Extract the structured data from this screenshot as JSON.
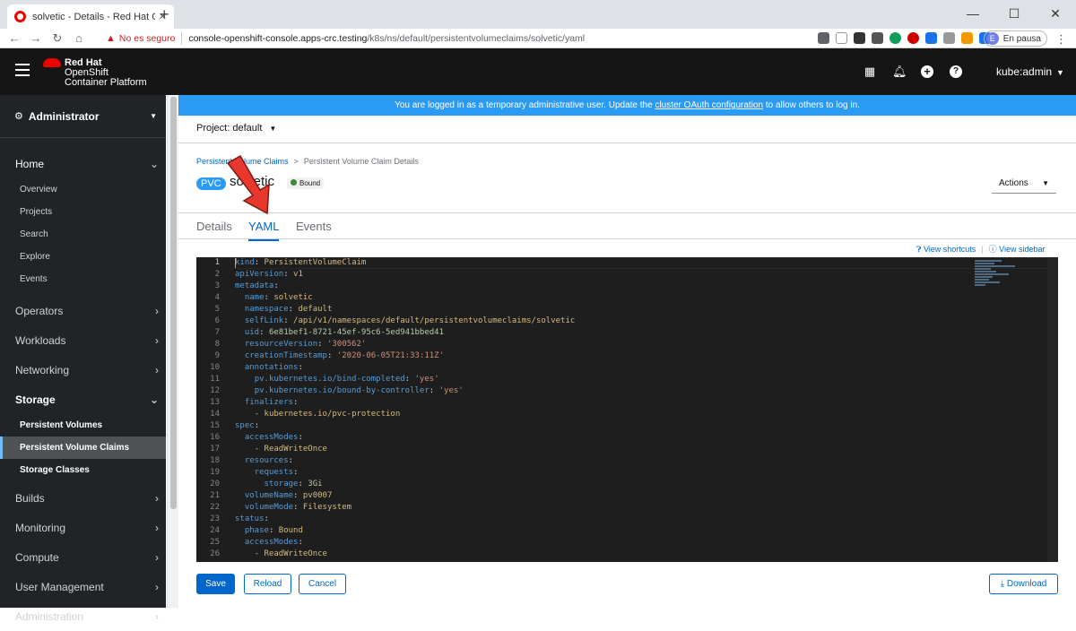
{
  "browser": {
    "tab_title": "solvetic - Details - Red Hat OpenS",
    "security_warning": "No es seguro",
    "url_prefix": "console-openshift-console.apps-crc.testing",
    "url_path": "/k8s/ns/default/persistentvolumeclaims/solvetic/yaml",
    "profile_initial": "E",
    "profile_status": "En pausa"
  },
  "masthead": {
    "brand_line1": "Red Hat",
    "brand_line2": "OpenShift",
    "brand_line3": "Container Platform",
    "user": "kube:admin"
  },
  "sidebar": {
    "perspective": "Administrator",
    "home": {
      "label": "Home",
      "items": [
        "Overview",
        "Projects",
        "Search",
        "Explore",
        "Events"
      ]
    },
    "operators": "Operators",
    "workloads": "Workloads",
    "networking": "Networking",
    "storage": {
      "label": "Storage",
      "items": [
        "Persistent Volumes",
        "Persistent Volume Claims",
        "Storage Classes"
      ]
    },
    "builds": "Builds",
    "monitoring": "Monitoring",
    "compute": "Compute",
    "user_management": "User Management",
    "administration": "Administration"
  },
  "banner": {
    "text_before": "You are logged in as a temporary administrative user. Update the",
    "link": "cluster OAuth configuration",
    "text_after": "to allow others to log in."
  },
  "project": {
    "label": "Project: default"
  },
  "breadcrumb": {
    "parent": "Persistent Volume Claims",
    "separator": ">",
    "current": "Persistent Volume Claim Details"
  },
  "resource": {
    "kind_badge": "PVC",
    "name": "solvetic",
    "status": "Bound",
    "actions_label": "Actions"
  },
  "tabs": [
    "Details",
    "YAML",
    "Events"
  ],
  "toolbar_links": {
    "shortcuts": "View shortcuts",
    "sidebar": "View sidebar"
  },
  "yaml_lines": [
    "kind: PersistentVolumeClaim",
    "apiVersion: v1",
    "metadata:",
    "  name: solvetic",
    "  namespace: default",
    "  selfLink: /api/v1/namespaces/default/persistentvolumeclaims/solvetic",
    "  uid: 6e81bef1-8721-45ef-95c6-5ed941bbed41",
    "  resourceVersion: '300562'",
    "  creationTimestamp: '2020-06-05T21:33:11Z'",
    "  annotations:",
    "    pv.kubernetes.io/bind-completed: 'yes'",
    "    pv.kubernetes.io/bound-by-controller: 'yes'",
    "  finalizers:",
    "    - kubernetes.io/pvc-protection",
    "spec:",
    "  accessModes:",
    "    - ReadWriteOnce",
    "  resources:",
    "    requests:",
    "      storage: 3Gi",
    "  volumeName: pv0007",
    "  volumeMode: Filesystem",
    "status:",
    "  phase: Bound",
    "  accessModes:",
    "    - ReadWriteOnce"
  ],
  "buttons": {
    "save": "Save",
    "reload": "Reload",
    "cancel": "Cancel",
    "download": "Download"
  },
  "colors": {
    "masthead": "#151515",
    "sidebar": "#212427",
    "banner": "#2b9af3",
    "link": "#0066cc",
    "annotation_arrow": "#e8372c"
  }
}
